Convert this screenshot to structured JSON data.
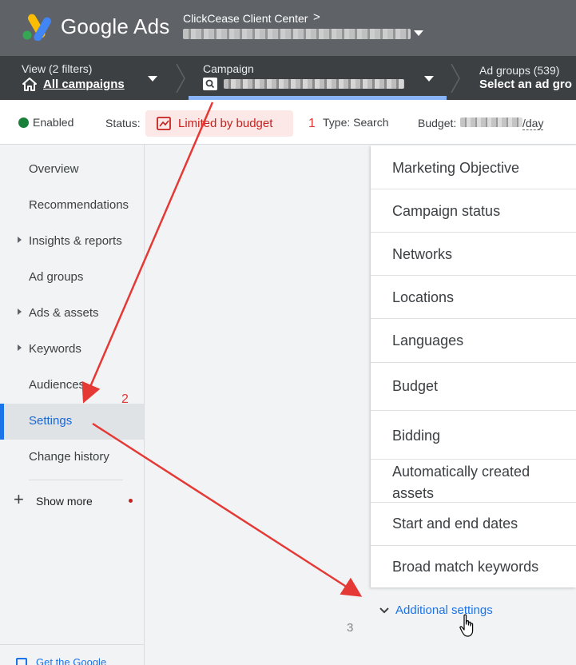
{
  "header": {
    "product_name": "Google Ads",
    "account_name": "ClickCease Client Center",
    "account_chevron": ">"
  },
  "navbar": {
    "view_label": "View (2 filters)",
    "view_value": "All campaigns",
    "campaign_label": "Campaign",
    "adgroups_label": "Ad groups (539)",
    "adgroups_value": "Select an ad gro"
  },
  "statusbar": {
    "enabled": "Enabled",
    "status_label": "Status:",
    "limited": "Limited by budget",
    "type": "Type: Search",
    "budget_label": "Budget:",
    "budget_suffix": "/day"
  },
  "sidebar": {
    "items": [
      {
        "label": "Overview",
        "expandable": false
      },
      {
        "label": "Recommendations",
        "expandable": false
      },
      {
        "label": "Insights & reports",
        "expandable": true
      },
      {
        "label": "Ad groups",
        "expandable": false
      },
      {
        "label": "Ads & assets",
        "expandable": true
      },
      {
        "label": "Keywords",
        "expandable": true
      },
      {
        "label": "Audiences",
        "expandable": false
      },
      {
        "label": "Settings",
        "expandable": false,
        "active": true
      },
      {
        "label": "Change history",
        "expandable": false
      }
    ],
    "show_more": "Show more",
    "footer": "Get the Google"
  },
  "settings": {
    "rows": [
      "Marketing Objective",
      "Campaign status",
      "Networks",
      "Locations",
      "Languages",
      "Budget",
      "Bidding",
      "Automatically created assets",
      "Start and end dates",
      "Broad match keywords"
    ],
    "additional": "Additional settings"
  },
  "annotations": {
    "one": "1",
    "two": "2",
    "three": "3",
    "color": "#e53935"
  },
  "colors": {
    "header_bg": "#5f6368",
    "nav_bg": "#3c4043",
    "accent": "#1a73e8",
    "enabled": "#188038",
    "limited": "#c5221f"
  }
}
